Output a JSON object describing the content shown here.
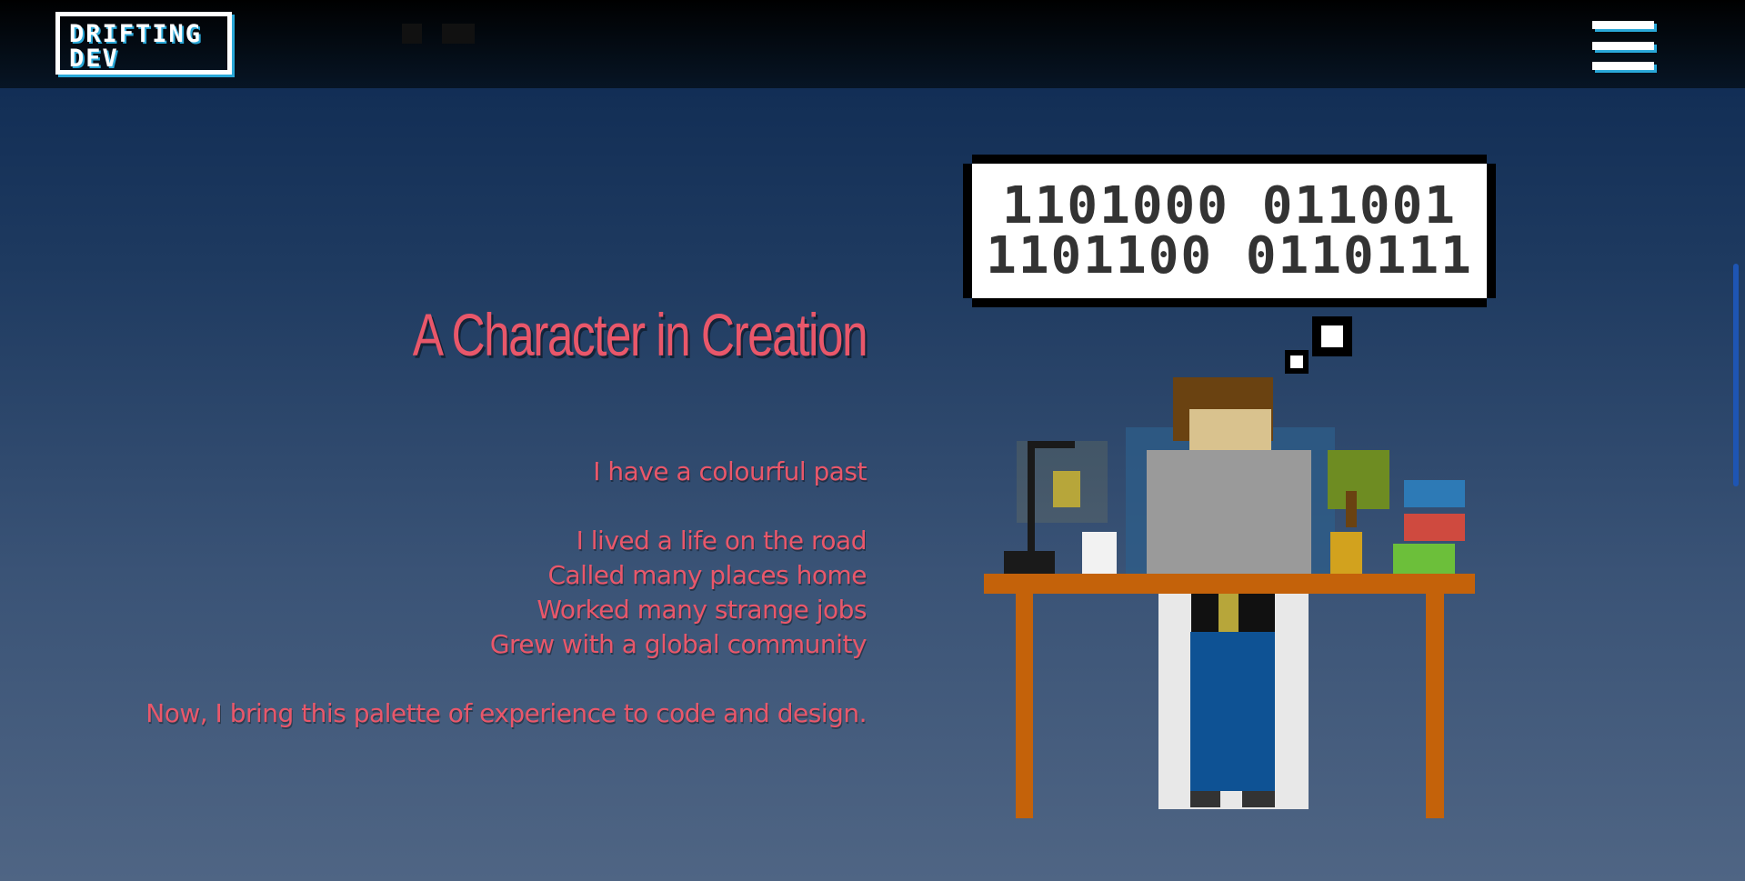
{
  "header": {
    "logo_line1": "DRIFTING",
    "logo_line2": "DEV"
  },
  "hero": {
    "title": "A Character in Creation",
    "intro": "I have a colourful past",
    "lines": [
      "I lived a life on the road",
      "Called many places home",
      "Worked many strange jobs",
      "Grew with a global community"
    ],
    "closing": "Now, I bring this palette of experience to code and design."
  },
  "thought_bubble": {
    "line1": "1101000 011001",
    "line2": "1101100 0110111"
  },
  "colors": {
    "accent": "#e9576a",
    "logo_shadow": "#2aa8d8",
    "desk": "#c4620a"
  }
}
